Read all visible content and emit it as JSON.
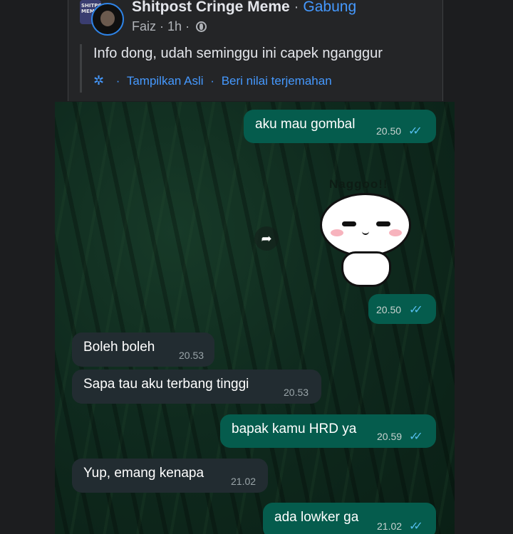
{
  "post": {
    "group_badge": "SHITPOST MEME",
    "group_name": "Shitpost Cringe Meme",
    "separator": "·",
    "join_label": "Gabung",
    "author": "Faiz",
    "time": "1h",
    "meta_sep": "·",
    "text": "Info dong, udah seminggu ini capek nganggur",
    "translation": {
      "show_original": "Tampilkan Asli",
      "rate": "Beri nilai terjemahan",
      "sep": "·"
    }
  },
  "chat": {
    "sticker_text": "Naggoo!!",
    "messages": [
      {
        "direction": "out",
        "text": "aku mau gombal",
        "time": "20.50",
        "read": true
      },
      {
        "direction": "out",
        "type": "sticker",
        "time": "20.50",
        "read": true
      },
      {
        "direction": "in",
        "text": "Boleh boleh",
        "time": "20.53"
      },
      {
        "direction": "in",
        "text": "Sapa tau aku terbang tinggi",
        "time": "20.53"
      },
      {
        "direction": "out",
        "text": "bapak kamu HRD ya",
        "time": "20.59",
        "read": true
      },
      {
        "direction": "in",
        "text": "Yup, emang kenapa",
        "time": "21.02"
      },
      {
        "direction": "out",
        "text": "ada lowker ga",
        "time": "21.02",
        "read": true
      }
    ],
    "ticks": "✓✓",
    "forward_icon": "➦"
  },
  "colors": {
    "background": "#1c1d1f",
    "post_bg": "#242527",
    "link": "#4599ff",
    "bubble_out": "#055c4d",
    "bubble_in": "#222c31",
    "read_ticks": "#53bdeb"
  }
}
